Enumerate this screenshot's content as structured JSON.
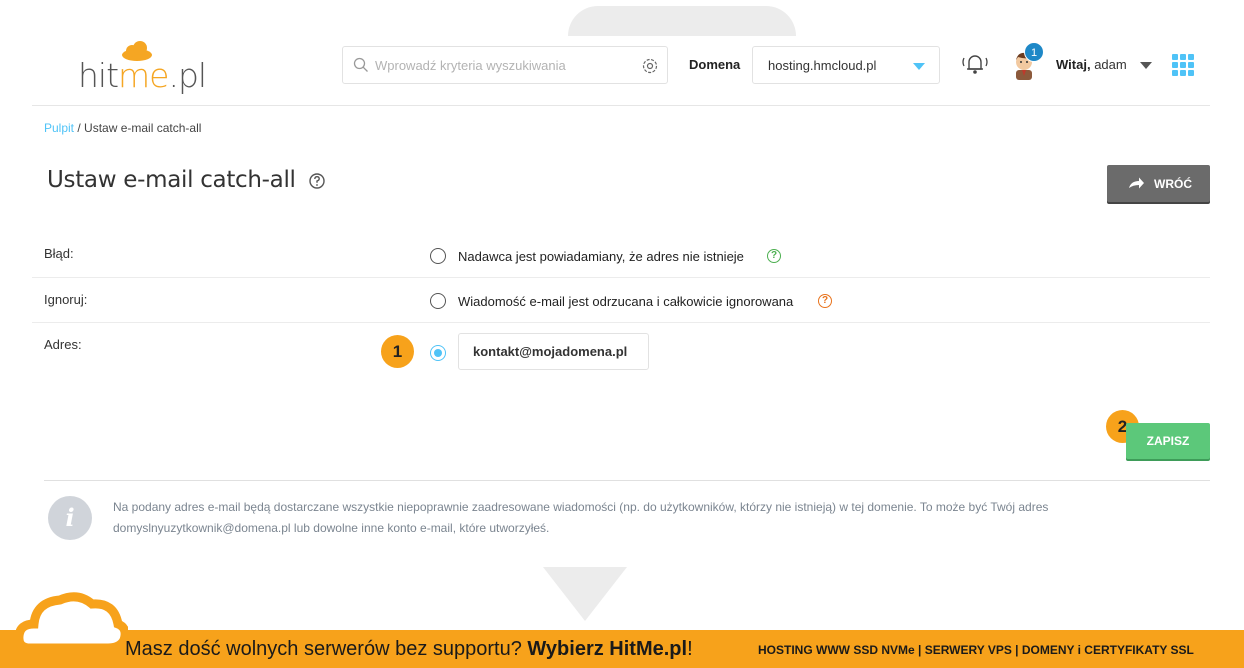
{
  "header": {
    "logo": {
      "part1": "hit",
      "part2": "me",
      "part3": ".pl"
    },
    "search": {
      "placeholder": "Wprowadź kryteria wyszukiwania"
    },
    "domain": {
      "label": "Domena",
      "value": "hosting.hmcloud.pl"
    },
    "notifications_count": "1",
    "greeting": {
      "prefix": "Witaj,",
      "username": "adam"
    },
    "icons": [
      "search-icon",
      "gear-icon",
      "bell-icon",
      "avatar",
      "apps-grid-icon"
    ]
  },
  "breadcrumb": {
    "root": "Pulpit",
    "separator": " / ",
    "current": "Ustaw e-mail catch-all"
  },
  "page": {
    "title": "Ustaw e-mail catch-all",
    "back_label": "WRÓĆ"
  },
  "form": {
    "rows": [
      {
        "label": "Błąd:",
        "option": "Nadawca jest powiadamiany, że adres nie istnieje",
        "selected": false,
        "help_color": "#4caf50"
      },
      {
        "label": "Ignoruj:",
        "option": "Wiadomość e-mail jest odrzucana i całkowicie ignorowana",
        "selected": false,
        "help_color": "#e8731d"
      },
      {
        "label": "Adres:",
        "email": "kontakt@mojadomena.pl",
        "selected": true
      }
    ],
    "save_label": "ZAPISZ"
  },
  "markers": [
    "1",
    "2"
  ],
  "info": {
    "text": "Na podany adres e-mail będą dostarczane wszystkie niepoprawnie zaadresowane wiadomości (np. do użytkowników, którzy nie istnieją) w tej domenie. To może być Twój adres domyslnyuzytkownik@domena.pl lub dowolne inne konto e-mail, które utworzyłeś."
  },
  "banner": {
    "text": "Masz dość wolnych serwerów bez supportu? ",
    "brand": "Wybierz HitMe.pl",
    "excl": "!",
    "right": "HOSTING WWW SSD NVMe | SERWERY VPS | DOMENY i CERTYFIKATY SSL"
  },
  "colors": {
    "accent": "#4fc3f7",
    "save": "#5cc87a",
    "back": "#6b6b6b",
    "marker": "#f7a21b",
    "banner": "#f7a21b"
  }
}
